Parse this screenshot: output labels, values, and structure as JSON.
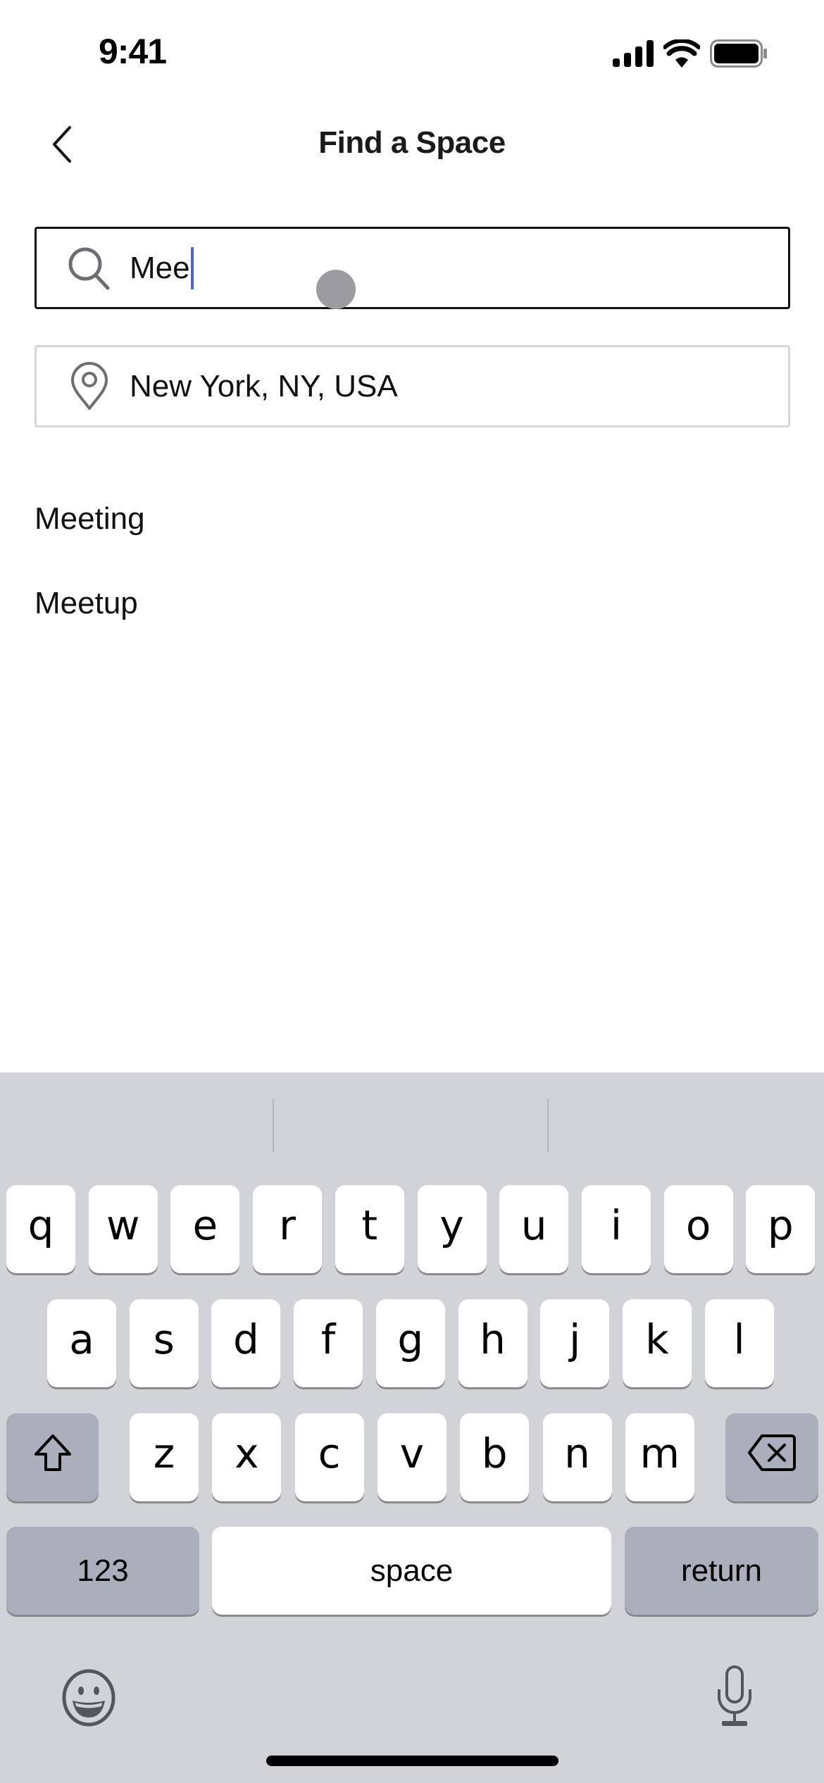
{
  "status_bar": {
    "time": "9:41",
    "icons": [
      "cellular-signal-icon",
      "wifi-icon",
      "battery-icon"
    ]
  },
  "header": {
    "back_icon": "chevron-left-icon",
    "title": "Find a Space"
  },
  "search": {
    "icon": "search-icon",
    "value": "Mee",
    "caret_color": "#4a63e8"
  },
  "location": {
    "icon": "location-pin-icon",
    "value": "New York, NY, USA"
  },
  "suggestions": [
    {
      "label": "Meeting"
    },
    {
      "label": "Meetup"
    }
  ],
  "keyboard": {
    "rows": [
      [
        "q",
        "w",
        "e",
        "r",
        "t",
        "y",
        "u",
        "i",
        "o",
        "p"
      ],
      [
        "a",
        "s",
        "d",
        "f",
        "g",
        "h",
        "j",
        "k",
        "l"
      ],
      [
        "z",
        "x",
        "c",
        "v",
        "b",
        "n",
        "m"
      ]
    ],
    "shift_icon": "shift-icon",
    "delete_icon": "backspace-icon",
    "numbers_label": "123",
    "space_label": "space",
    "return_label": "return",
    "emoji_icon": "emoji-icon",
    "mic_icon": "microphone-icon"
  },
  "colors": {
    "keyboard_bg": "#d2d3d8",
    "function_key_bg": "#abafbb",
    "caret": "#4a63e8"
  }
}
